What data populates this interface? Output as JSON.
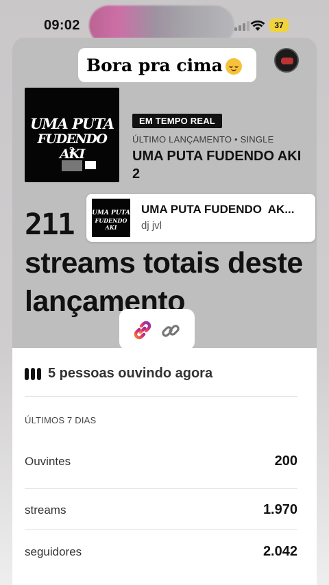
{
  "status_bar": {
    "time": "09:02",
    "battery": "37"
  },
  "story": {
    "caption": "Bora pra cima",
    "caption_emoji": "relieved-face-emoji"
  },
  "release": {
    "badge": "EM TEMPO REAL",
    "meta": "ÚLTIMO LANÇAMENTO • SINGLE",
    "title": "UMA PUTA FUDENDO AKI 2",
    "cover_text_line1": "UMA PUTA",
    "cover_text_line2": "FUDENDO AKI",
    "cover_text_line3": "2"
  },
  "total_streams": {
    "number": "211",
    "label": "streams totais deste lançamento"
  },
  "now_playing": {
    "title": "UMA PUTA FUDENDO  AK...",
    "artist": "dj jvl"
  },
  "live": {
    "text": "5 pessoas ouvindo agora"
  },
  "stats": {
    "section_label": "ÚLTIMOS 7 DIAS",
    "rows": [
      {
        "label": "Ouvintes",
        "value": "200"
      },
      {
        "label": "streams",
        "value": "1.970"
      },
      {
        "label": "seguidores",
        "value": "2.042"
      }
    ]
  },
  "colors": {
    "badge_bg": "#111111",
    "battery": "#f1d33e",
    "link_gradient_start": "#f58529",
    "link_gradient_end": "#c13584"
  }
}
